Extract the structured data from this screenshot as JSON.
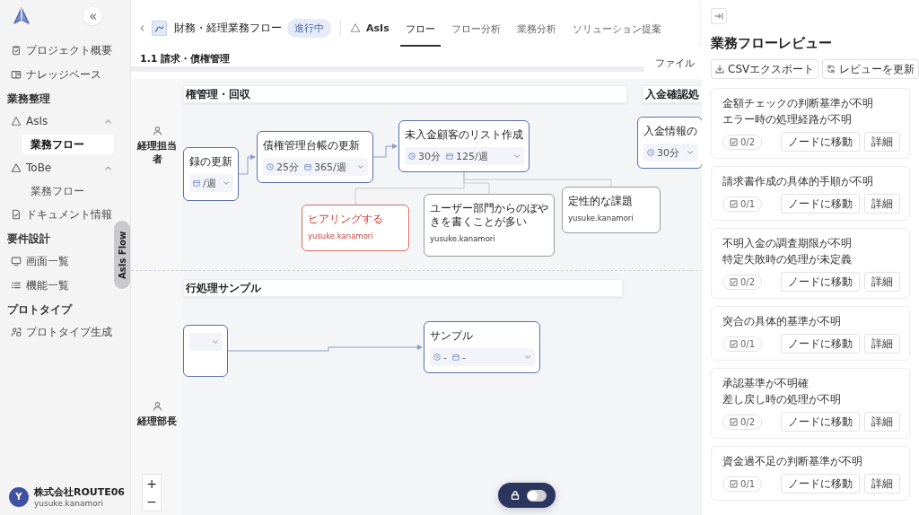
{
  "sidebar": {
    "nav": [
      {
        "kind": "link",
        "label": "プロジェクト概要",
        "selected": false
      },
      {
        "kind": "link",
        "label": "ナレッジベース",
        "selected": false
      },
      {
        "kind": "heading",
        "label": "業務整理"
      },
      {
        "kind": "group",
        "label": "AsIs",
        "expanded": true,
        "children": [
          {
            "label": "業務フロー",
            "selected": true
          }
        ]
      },
      {
        "kind": "group",
        "label": "ToBe",
        "expanded": true,
        "children": [
          {
            "label": "業務フロー",
            "selected": false
          }
        ]
      },
      {
        "kind": "link",
        "label": "ドキュメント情報",
        "selected": false
      },
      {
        "kind": "heading",
        "label": "要件設計"
      },
      {
        "kind": "link",
        "label": "画面一覧",
        "selected": false
      },
      {
        "kind": "link",
        "label": "機能一覧",
        "selected": false
      },
      {
        "kind": "heading",
        "label": "プロトタイプ"
      },
      {
        "kind": "link",
        "label": "プロトタイプ生成",
        "selected": false
      }
    ],
    "user": {
      "initial": "Y",
      "company": "株式会社ROUTE06",
      "account": "yusuke.kanamori"
    }
  },
  "side_tab": "AsIs Flow",
  "header": {
    "title": "財務・経理業務フロー",
    "status": "進行中",
    "mode": "AsIs",
    "tabs": [
      {
        "label": "フロー",
        "selected": true
      },
      {
        "label": "フロー分析",
        "selected": false
      },
      {
        "label": "業務分析",
        "selected": false
      },
      {
        "label": "ソリューション提案",
        "selected": false
      }
    ]
  },
  "canvas": {
    "section_title": "1.1 請求・債権管理",
    "file_label": "ファイル",
    "lanes": [
      {
        "name": "経理担当者"
      },
      {
        "name": "経理部長"
      }
    ],
    "groups": [
      {
        "title": "権管理・回収"
      },
      {
        "title": "入金確認処"
      },
      {
        "title": "行処理サンプル"
      }
    ],
    "nodes": [
      {
        "kind": "task",
        "title": "録の更新",
        "frequency": "/週"
      },
      {
        "kind": "task",
        "title": "債権管理台帳の更新",
        "duration": "25分",
        "frequency": "365/週"
      },
      {
        "kind": "task",
        "title": "未入金顧客のリスト作成",
        "duration": "30分",
        "frequency": "125/週"
      },
      {
        "kind": "task",
        "title": "入金情報の",
        "duration": "30分"
      },
      {
        "kind": "action",
        "title": "ヒアリングする",
        "author": "yusuke.kanamori"
      },
      {
        "kind": "note",
        "title": "ユーザー部門からのぼやきを書くことが多い",
        "author": "yusuke.kanamori"
      },
      {
        "kind": "note",
        "title": "定性的な課題",
        "author": "yusuke.kanamori"
      },
      {
        "kind": "task"
      },
      {
        "kind": "task",
        "title": "サンプル",
        "duration": "-",
        "frequency": "-"
      }
    ],
    "zoom_controls": [
      "+",
      "−"
    ],
    "lock_toggle": {
      "on": false
    }
  },
  "panel": {
    "title": "業務フローレビュー",
    "buttons": [
      "CSVエクスポート",
      "レビューを更新"
    ],
    "reviews": [
      {
        "issues": [
          "金額チェックの判断基準が不明",
          "エラー時の処理経路が不明"
        ],
        "progress": "0/2",
        "actions": [
          "ノードに移動",
          "詳細"
        ]
      },
      {
        "issues": [
          "請求書作成の具体的手順が不明"
        ],
        "progress": "0/1",
        "actions": [
          "ノードに移動",
          "詳細"
        ]
      },
      {
        "issues": [
          "不明入金の調査期限が不明",
          "特定失敗時の処理が未定義"
        ],
        "progress": "0/2",
        "actions": [
          "ノードに移動",
          "詳細"
        ]
      },
      {
        "issues": [
          "突合の具体的基準が不明"
        ],
        "progress": "0/1",
        "actions": [
          "ノードに移動",
          "詳細"
        ]
      },
      {
        "issues": [
          "承認基準が不明確",
          "差し戻し時の処理が不明"
        ],
        "progress": "0/2",
        "actions": [
          "ノードに移動",
          "詳細"
        ]
      },
      {
        "issues": [
          "資金過不足の判断基準が不明"
        ],
        "progress": "0/1",
        "actions": [
          "ノードに移動",
          "詳細"
        ]
      }
    ]
  }
}
